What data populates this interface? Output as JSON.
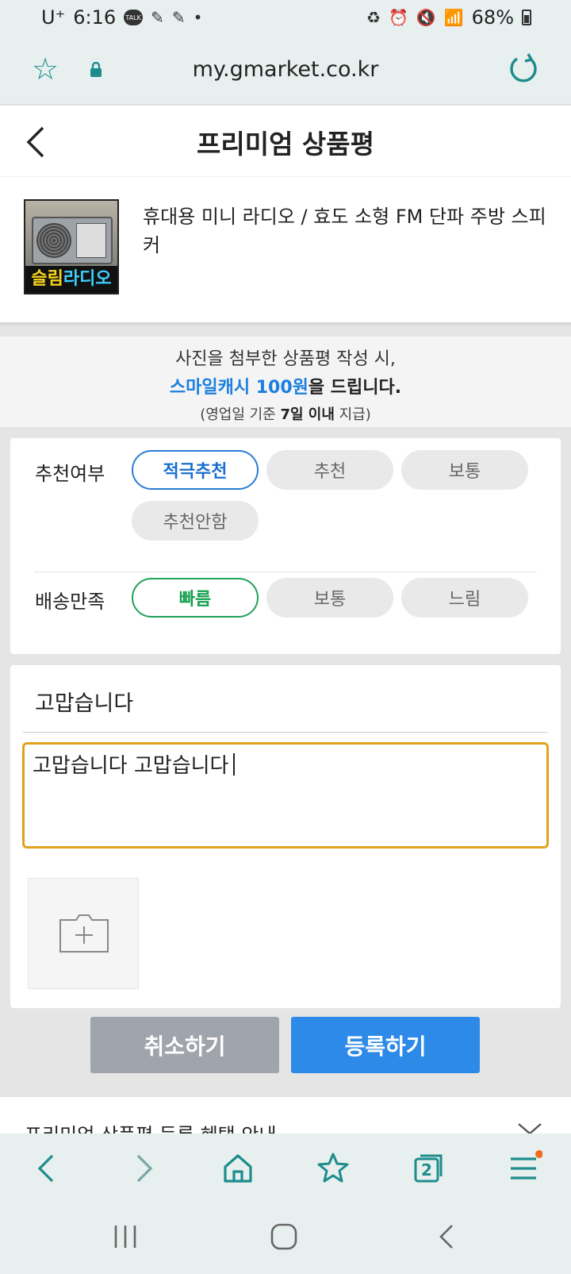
{
  "status_bar": {
    "carrier": "U⁺",
    "time": "6:16",
    "talk_label": "TALK",
    "battery": "68%"
  },
  "browser": {
    "url": "my.gmarket.co.kr"
  },
  "header": {
    "title": "프리미엄 상품평"
  },
  "product": {
    "name": "휴대용 미니 라디오 / 효도 소형 FM 단파 주방 스피커",
    "thumb_label_a": "슬림",
    "thumb_label_b": "라디오"
  },
  "banner": {
    "line1": "사진을 첨부한 상품평 작성 시,",
    "line2_highlight": "스마일캐시 100원",
    "line2_rest": "을 드립니다.",
    "line3_prefix": "(영업일 기준 ",
    "line3_bold": "7일 이내",
    "line3_suffix": " 지급)"
  },
  "ratings": {
    "recommend": {
      "label": "추천여부",
      "options": [
        "적극추천",
        "추천",
        "보통",
        "추천안함"
      ],
      "selected": "적극추천"
    },
    "delivery": {
      "label": "배송만족",
      "options": [
        "빠름",
        "보통",
        "느림"
      ],
      "selected": "빠름"
    }
  },
  "review": {
    "title": "고맙습니다",
    "body": "고맙습니다 고맙습니다"
  },
  "actions": {
    "cancel": "취소하기",
    "submit": "등록하기"
  },
  "benefit": {
    "label": "프리미엄 상품평 등록 혜택 안내"
  },
  "browser_toolbar": {
    "tab_count": "2"
  },
  "colors": {
    "accent_blue": "#2d8ae8",
    "accent_green": "#1fa25a",
    "focus_border": "#e1a21b",
    "browser_teal": "#1e8c8c"
  }
}
